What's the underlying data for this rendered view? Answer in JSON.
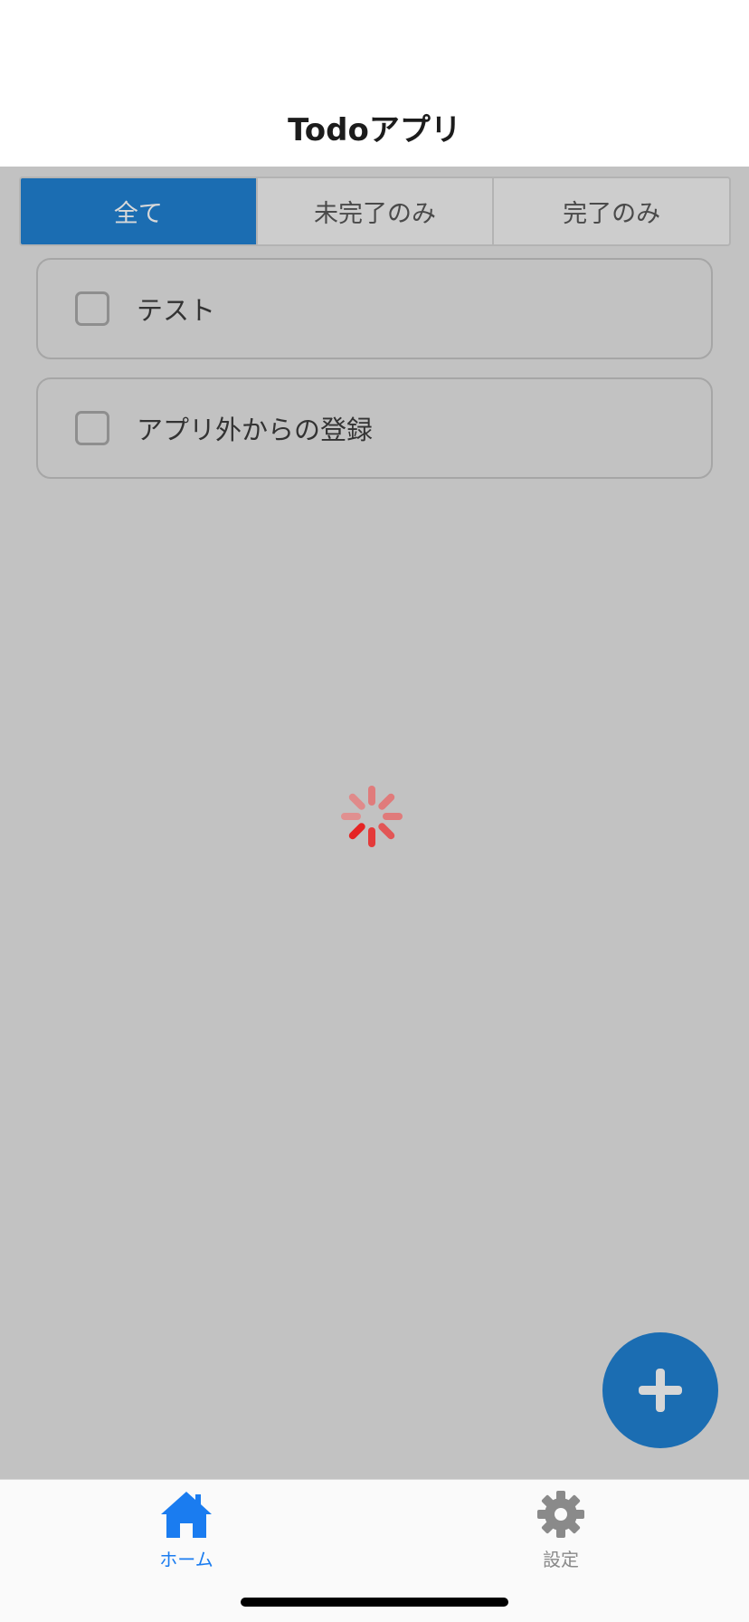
{
  "header": {
    "title": "Todoアプリ"
  },
  "filter": {
    "segments": [
      {
        "label": "全て",
        "active": true
      },
      {
        "label": "未完了のみ",
        "active": false
      },
      {
        "label": "完了のみ",
        "active": false
      }
    ]
  },
  "todos": [
    {
      "label": "テスト",
      "completed": false
    },
    {
      "label": "アプリ外からの登録",
      "completed": false
    }
  ],
  "loading": {
    "icon": "spinner-icon",
    "color": "#e53935"
  },
  "fab": {
    "icon": "plus-icon",
    "color": "#1b6db2"
  },
  "tabbar": {
    "items": [
      {
        "label": "ホーム",
        "icon": "home-icon",
        "active": true,
        "color": "#1a7cf0"
      },
      {
        "label": "設定",
        "icon": "gear-icon",
        "active": false,
        "color": "#8a8a8a"
      }
    ]
  },
  "colors": {
    "accent": "#1b6db2",
    "overlay": "#c2c2c2"
  }
}
